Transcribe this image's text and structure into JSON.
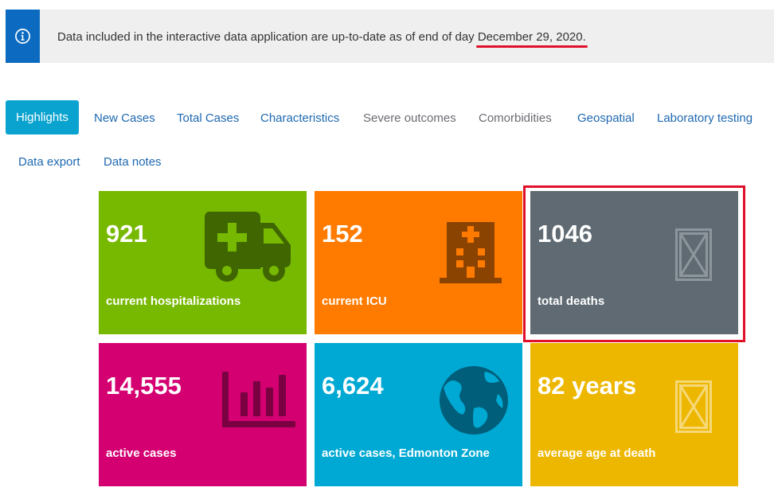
{
  "notice": {
    "icon": "info-icon",
    "text": "Data included in the interactive data application are up-to-date as of end of day ",
    "date": "December 29, 2020."
  },
  "tabs": [
    {
      "label": "Highlights",
      "active": true
    },
    {
      "label": "New Cases"
    },
    {
      "label": "Total Cases"
    },
    {
      "label": "Characteristics"
    },
    {
      "label": "Severe outcomes"
    },
    {
      "label": "Comorbidities"
    },
    {
      "label": "Geospatial"
    },
    {
      "label": "Laboratory testing"
    },
    {
      "label": "Data export"
    },
    {
      "label": "Data notes"
    }
  ],
  "tiles": [
    {
      "value": "921",
      "label": "current hospitalizations",
      "icon": "ambulance-icon",
      "color": "#77b800"
    },
    {
      "value": "152",
      "label": "current ICU",
      "icon": "hospital-icon",
      "color": "#ff7b00"
    },
    {
      "value": "1046",
      "label": "total deaths",
      "icon": "missing-image-icon",
      "color": "#5f6a72"
    },
    {
      "value": "14,555",
      "label": "active cases",
      "icon": "bar-chart-icon",
      "color": "#d40072"
    },
    {
      "value": "6,624",
      "label": "active cases, Edmonton Zone",
      "icon": "globe-icon",
      "color": "#00a9d3"
    },
    {
      "value": "82 years",
      "label": "average age at death",
      "icon": "missing-image-icon",
      "color": "#edb700"
    }
  ],
  "colors": {
    "notice_bg": "#efefef",
    "notice_icon_bg": "#0c6bc0",
    "tab_active_bg": "#0aa3cf",
    "link": "#1e68b0",
    "annotation_red": "#e0102a"
  }
}
